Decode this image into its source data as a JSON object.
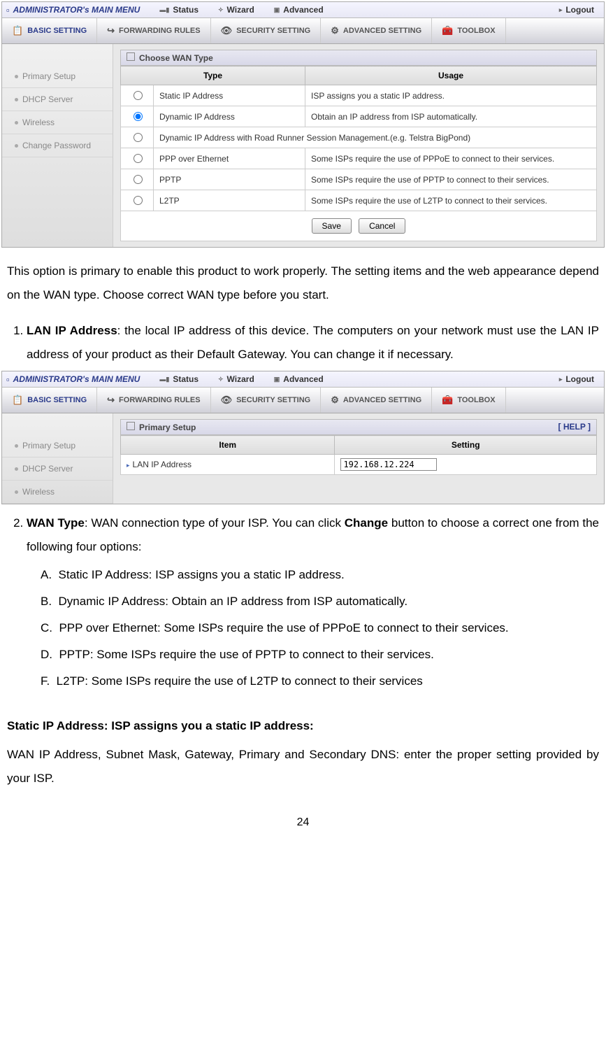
{
  "topbar": {
    "title": "ADMINISTRATOR's MAIN MENU",
    "status": "Status",
    "wizard": "Wizard",
    "advanced": "Advanced",
    "logout": "Logout"
  },
  "tabs": {
    "basic": "BASIC SETTING",
    "forwarding": "FORWARDING RULES",
    "security": "SECURITY SETTING",
    "advanced": "ADVANCED SETTING",
    "toolbox": "TOOLBOX"
  },
  "sidebar1": {
    "items": [
      "Primary Setup",
      "DHCP Server",
      "Wireless",
      "Change Password"
    ]
  },
  "sidebar2": {
    "items": [
      "Primary Setup",
      "DHCP Server",
      "Wireless"
    ]
  },
  "panel1": {
    "title": "Choose WAN Type",
    "th_type": "Type",
    "th_usage": "Usage",
    "rows": [
      {
        "type": "Static IP Address",
        "usage": "ISP assigns you a static IP address.",
        "checked": false
      },
      {
        "type": "Dynamic IP Address",
        "usage": "Obtain an IP address from ISP automatically.",
        "checked": true
      },
      {
        "type": "Dynamic IP Address with Road Runner Session Management.(e.g. Telstra BigPond)",
        "usage": "",
        "checked": false,
        "span": true
      },
      {
        "type": "PPP over Ethernet",
        "usage": "Some ISPs require the use of PPPoE to connect to their services.",
        "checked": false
      },
      {
        "type": "PPTP",
        "usage": "Some ISPs require the use of PPTP to connect to their services.",
        "checked": false
      },
      {
        "type": "L2TP",
        "usage": "Some ISPs require the use of L2TP to connect to their services.",
        "checked": false
      }
    ],
    "save": "Save",
    "cancel": "Cancel"
  },
  "panel2": {
    "title": "Primary Setup",
    "help": "[ HELP ]",
    "th_item": "Item",
    "th_setting": "Setting",
    "row_label": "LAN IP Address",
    "row_value": "192.168.12.224"
  },
  "doc": {
    "intro": "This option is primary to enable this product to work properly. The setting items and the web appearance depend on the WAN type. Choose correct WAN type before you start.",
    "li1_bold": "LAN IP Address",
    "li1_rest": ": the local IP address of this device. The computers on your network must use the LAN IP address of your product as their Default Gateway. You can change it if necessary.",
    "li2_bold": "WAN Type",
    "li2_rest": ": WAN connection type of your ISP. You can click ",
    "li2_change": "Change",
    "li2_rest2": " button to choose a correct one from the following four options:",
    "subA": "Static IP Address: ISP assigns you a static IP address.",
    "subB": "Dynamic IP Address: Obtain an IP address from ISP automatically.",
    "subC": "PPP over Ethernet: Some ISPs require the use of  PPPoE to connect to their services.",
    "subD": "PPTP: Some ISPs require the use of   PPTP to connect to their services.",
    "subF": "L2TP: Some ISPs require the use of   L2TP to connect to their services",
    "static_h": "Static IP Address: ISP assigns you a static IP address:",
    "static_p": "WAN IP Address, Subnet Mask, Gateway, Primary and Secondary DNS: enter the proper setting provided by your ISP.",
    "page": "24"
  }
}
